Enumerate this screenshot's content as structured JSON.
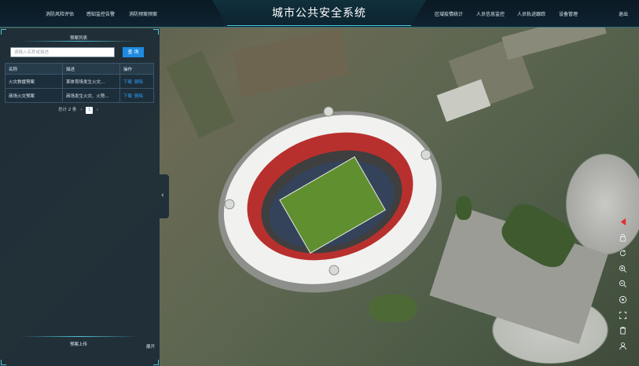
{
  "app": {
    "title": "城市公共安全系统"
  },
  "nav": {
    "left": [
      "消防风险评估",
      "感知监控告警",
      "消防预案预案"
    ],
    "right": [
      "区域疫情统计",
      "人员信息监控",
      "人员轨迹跟踪",
      "设备管理"
    ],
    "exit": "退出"
  },
  "panel": {
    "title": "预案列表",
    "search": {
      "placeholder": "请输入名称或描述",
      "value": "",
      "button": "查 询"
    },
    "table": {
      "headers": [
        "名称",
        "描述",
        "操作"
      ],
      "rows": [
        {
          "name": "火灾救援预案",
          "desc": "某体育场发生火灾...",
          "ops": [
            "下载",
            "删除"
          ]
        },
        {
          "name": "商场火灾预案",
          "desc": "商场发生火灾、火势...",
          "ops": [
            "下载",
            "删除"
          ]
        }
      ]
    },
    "pager": {
      "total": "总计 2 条",
      "prev": "‹",
      "current": "1",
      "next": "›"
    },
    "bottom_title": "预案上传",
    "expand": "展开",
    "collapse_glyph": "‹"
  },
  "tools": [
    "alert-icon",
    "lock-icon",
    "refresh-icon",
    "zoom-in-icon",
    "zoom-out-icon",
    "target-icon",
    "fullscreen-icon",
    "trash-icon",
    "user-icon"
  ],
  "colors": {
    "accent": "#1e8be0",
    "frame": "#4fc3d8",
    "alert": "#e03030"
  }
}
